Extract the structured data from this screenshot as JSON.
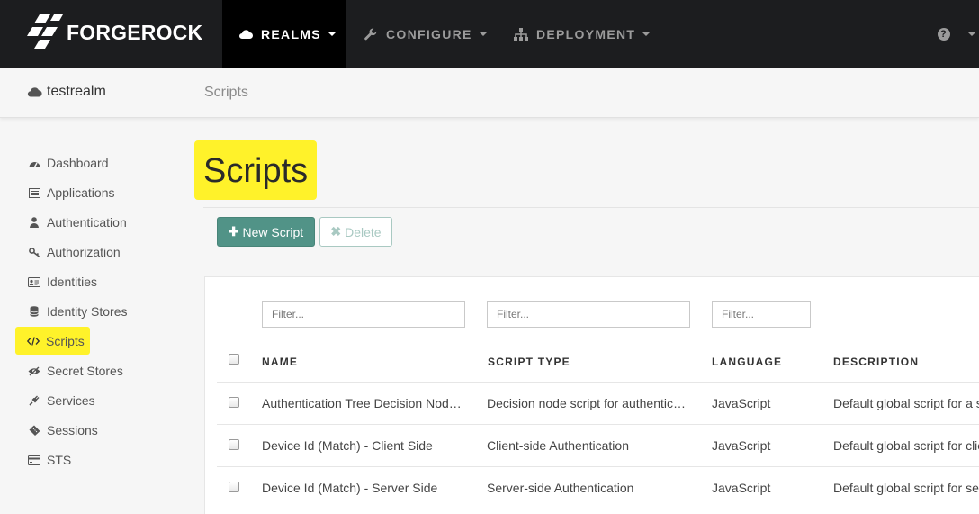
{
  "brand": {
    "name": "FORGEROCK"
  },
  "nav": {
    "realms": "REALMS",
    "configure": "CONFIGURE",
    "deployment": "DEPLOYMENT",
    "help": "?"
  },
  "subheader": {
    "realm": "testrealm",
    "breadcrumb": "Scripts"
  },
  "sidebar": {
    "items": [
      {
        "label": "Dashboard",
        "icon": "dashboard-icon"
      },
      {
        "label": "Applications",
        "icon": "list-icon"
      },
      {
        "label": "Authentication",
        "icon": "user-icon"
      },
      {
        "label": "Authorization",
        "icon": "key-icon"
      },
      {
        "label": "Identities",
        "icon": "id-card-icon"
      },
      {
        "label": "Identity Stores",
        "icon": "database-icon"
      },
      {
        "label": "Scripts",
        "icon": "code-icon",
        "active": true
      },
      {
        "label": "Secret Stores",
        "icon": "eye-slash-icon"
      },
      {
        "label": "Services",
        "icon": "plug-icon"
      },
      {
        "label": "Sessions",
        "icon": "ticket-icon"
      },
      {
        "label": "STS",
        "icon": "credit-card-icon"
      }
    ]
  },
  "main": {
    "title": "Scripts",
    "new_button": "New Script",
    "delete_button": "Delete",
    "filters": {
      "name": "Filter...",
      "type": "Filter...",
      "language": "Filter..."
    },
    "columns": [
      "NAME",
      "SCRIPT TYPE",
      "LANGUAGE",
      "DESCRIPTION"
    ],
    "rows": [
      {
        "name": "Authentication Tree Decision Nod…",
        "type": "Decision node script for authentic…",
        "language": "JavaScript",
        "description": "Default global script for a s"
      },
      {
        "name": "Device Id (Match) - Client Side",
        "type": "Client-side Authentication",
        "language": "JavaScript",
        "description": "Default global script for clie"
      },
      {
        "name": "Device Id (Match) - Server Side",
        "type": "Server-side Authentication",
        "language": "JavaScript",
        "description": "Default global script for se"
      }
    ]
  },
  "colors": {
    "highlight": "#fff22a",
    "primary_button": "#519387",
    "navbar": "#1c1d1f"
  }
}
